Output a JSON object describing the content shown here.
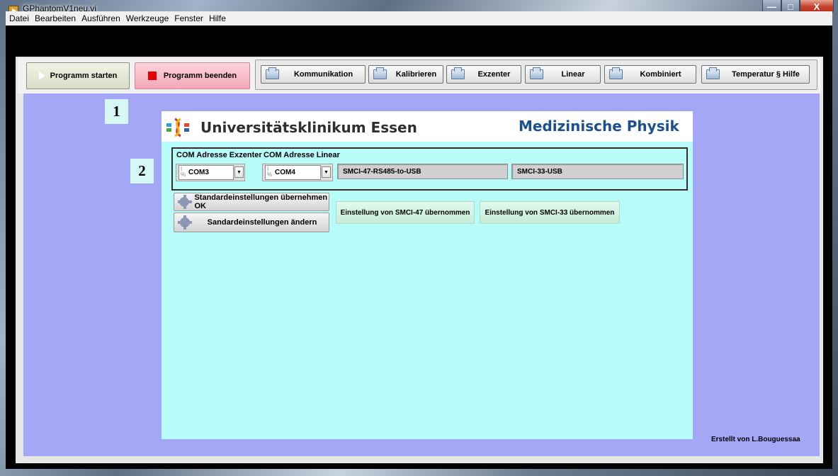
{
  "window": {
    "title": "GPhantomV1neu.vi",
    "minimize": "—",
    "maximize": "□",
    "close": "X"
  },
  "menu": [
    "Datei",
    "Bearbeiten",
    "Ausführen",
    "Werkzeuge",
    "Fenster",
    "Hilfe"
  ],
  "toolbar": {
    "start_label": "Programm starten",
    "stop_label": "Programm beenden",
    "tabs": [
      "Kommunikation",
      "Kalibrieren",
      "Exzenter",
      "Linear",
      "Kombiniert",
      "Temperatur § Hilfe"
    ]
  },
  "markers": {
    "one": "1",
    "two": "2"
  },
  "header": {
    "university": "Universitätsklinikum Essen",
    "department": "Medizinische Physik"
  },
  "com": {
    "exzenter_label": "COM Adresse Exzenter",
    "linear_label": "COM Adresse Linear",
    "exzenter_value": "COM3",
    "linear_value": "COM4",
    "device_1": "SMCI-47-RS485-to-USB",
    "device_2": "SMCI-33-USB"
  },
  "actions": {
    "apply_defaults": "Standardeinstellungen übernehmen OK",
    "change_defaults": "Sandardeinstellungen ändern",
    "status_47": "Einstellung  von SMCI-47 übernommen",
    "status_33": "Einstellung von SMCI-33 übernommen"
  },
  "footer": {
    "credit": "Erstellt von L.Bouguessaa"
  }
}
